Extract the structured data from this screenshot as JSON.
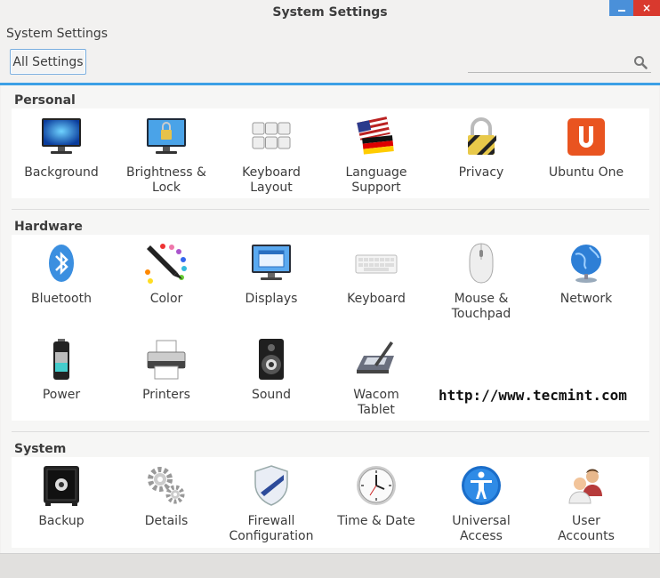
{
  "window": {
    "title": "System Settings",
    "minimize_label": "",
    "close_label": "×"
  },
  "breadcrumb": {
    "label": "System Settings",
    "all_settings": "All Settings"
  },
  "search": {
    "placeholder": "",
    "value": ""
  },
  "sections": {
    "personal": {
      "title": "Personal",
      "items": [
        "Background",
        "Brightness &\nLock",
        "Keyboard\nLayout",
        "Language\nSupport",
        "Privacy",
        "Ubuntu One"
      ]
    },
    "hardware": {
      "title": "Hardware",
      "items": [
        "Bluetooth",
        "Color",
        "Displays",
        "Keyboard",
        "Mouse &\nTouchpad",
        "Network",
        "Power",
        "Printers",
        "Sound",
        "Wacom\nTablet"
      ]
    },
    "system": {
      "title": "System",
      "items": [
        "Backup",
        "Details",
        "Firewall\nConfiguration",
        "Time & Date",
        "Universal\nAccess",
        "User\nAccounts"
      ]
    }
  },
  "watermark": "http://www.tecmint.com",
  "colors": {
    "accent": "#3ca0e6",
    "close": "#d9392e",
    "minimize": "#4a90d9"
  }
}
